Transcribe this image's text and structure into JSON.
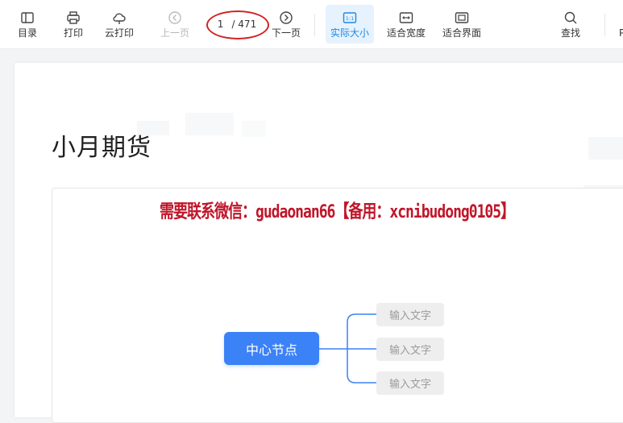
{
  "toolbar": {
    "toc": "目录",
    "print": "打印",
    "cloud_print": "云打印",
    "prev_page": "上一页",
    "page_current": "1",
    "page_total": "/ 471",
    "next_page": "下一页",
    "actual_size": "实际大小",
    "fit_width": "适合宽度",
    "fit_page": "适合界面",
    "search": "查找",
    "truncated": "P",
    "actual_size_icon_text": "1:1"
  },
  "document": {
    "title": "小月期货",
    "watermark": "需要联系微信：gudaonan66【备用：xcnibudong0105】"
  },
  "mindmap": {
    "center": "中心节点",
    "children": [
      "输入文字",
      "输入文字",
      "输入文字"
    ]
  },
  "colors": {
    "accent": "#1e88e5",
    "center_node": "#3b82f6",
    "annotation_circle": "#d32222",
    "watermark": "#c0162a"
  }
}
